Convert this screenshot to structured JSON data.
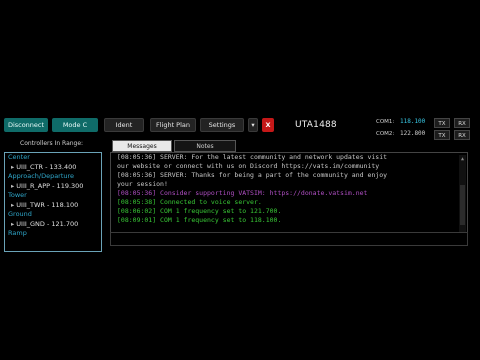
{
  "toolbar": {
    "disconnect": "Disconnect",
    "mode": "Mode C",
    "ident": "Ident",
    "flight_plan": "Flight Plan",
    "settings": "Settings",
    "dropdown": "▾",
    "close": "X"
  },
  "callsign": "UTA1488",
  "radio": {
    "com1_label": "COM1:",
    "com1_freq": "118.100",
    "com2_label": "COM2:",
    "com2_freq": "122.800",
    "tx": "TX",
    "rx": "RX"
  },
  "controllers": {
    "title": "Controllers In Range:",
    "groups": [
      {
        "name": "Center",
        "items": [
          "UIII_CTR - 133.400"
        ]
      },
      {
        "name": "Approach/Departure",
        "items": [
          "UIII_R_APP - 119.300"
        ]
      },
      {
        "name": "Tower",
        "items": [
          "UIII_TWR - 118.100"
        ]
      },
      {
        "name": "Ground",
        "items": [
          "UIII_GND - 121.700"
        ]
      },
      {
        "name": "Ramp",
        "items": []
      }
    ]
  },
  "tabs": [
    "Messages",
    "Notes"
  ],
  "messages": [
    {
      "text": "[08:05:36] SERVER: For the latest community and network updates visit",
      "color": "#c9c9c9"
    },
    {
      "text": "our website or connect with us on Discord https://vats.im/community",
      "color": "#c9c9c9"
    },
    {
      "text": "[08:05:36] SERVER: Thanks for being a part of the community and enjoy",
      "color": "#c9c9c9"
    },
    {
      "text": "your session!",
      "color": "#c9c9c9"
    },
    {
      "text": "[08:05:36] Consider supporting VATSIM: https://donate.vatsim.net",
      "color": "#b04fc4"
    },
    {
      "text": "[08:05:38] Connected to voice server.",
      "color": "#39c936"
    },
    {
      "text": "[08:06:02] COM 1 frequency set to 121.700.",
      "color": "#39c936"
    },
    {
      "text": "[08:09:01] COM 1 frequency set to 118.100.",
      "color": "#39c936"
    }
  ],
  "colors": {
    "accent_green": "#0f6b68",
    "close_red": "#c51818",
    "message_green": "#39c936",
    "message_purple": "#b04fc4",
    "group_blue": "#2fa6c9"
  }
}
